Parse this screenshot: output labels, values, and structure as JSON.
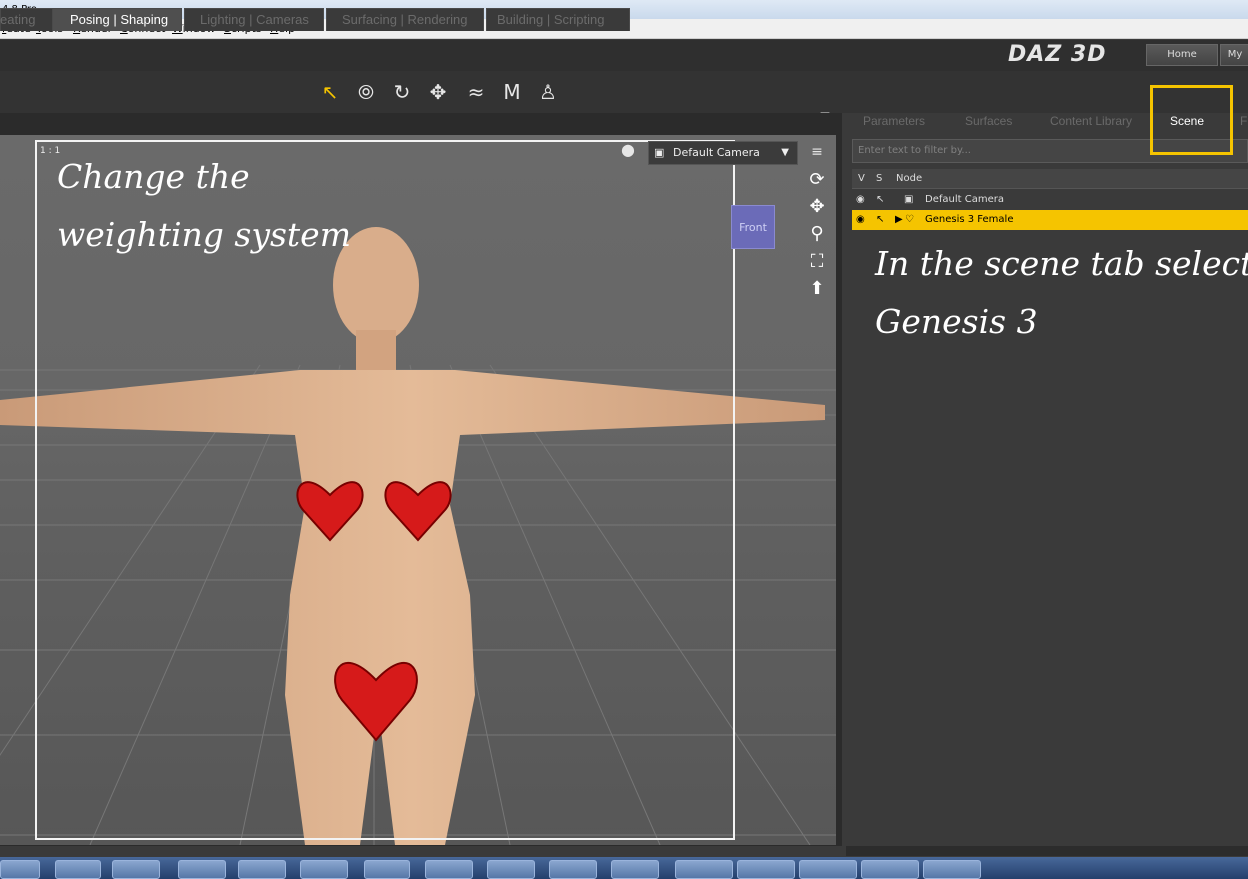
{
  "window": {
    "title": "4.8 Pro"
  },
  "menu": [
    "reate",
    "Tools",
    "Render",
    "Connect",
    "Window",
    "Scripts",
    "Help"
  ],
  "layout_tabs": [
    {
      "label": "eating",
      "active": false
    },
    {
      "label": "Posing | Shaping",
      "active": true
    },
    {
      "label": "Lighting | Cameras",
      "active": false
    },
    {
      "label": "Surfacing | Rendering",
      "active": false
    },
    {
      "label": "Building | Scripting",
      "active": false
    }
  ],
  "brand": {
    "logo": "DAZ 3D",
    "nav": [
      "Home",
      "My"
    ]
  },
  "tools": [
    "pointer-icon",
    "universal-tool-icon",
    "rotate-tool-icon",
    "translate-tool-icon",
    "scale-tool-icon",
    "morph-tool-icon",
    "figure-tool-icon"
  ],
  "viewport": {
    "ratio": "1 : 1",
    "camera": "Default Camera",
    "nav_cube_label": "Front",
    "annotation": [
      "Change the",
      "weighting system"
    ]
  },
  "right_tabs": [
    {
      "label": "Parameters",
      "active": false
    },
    {
      "label": "Surfaces",
      "active": false
    },
    {
      "label": "Content Library",
      "active": false
    },
    {
      "label": "Scene",
      "active": true
    },
    {
      "label": "F",
      "active": false
    }
  ],
  "scene": {
    "filter_placeholder": "Enter text to filter by...",
    "columns": [
      "V",
      "S",
      "Node"
    ],
    "nodes": [
      {
        "name": "Default Camera",
        "selected": false
      },
      {
        "name": "Genesis 3 Female",
        "selected": true
      }
    ],
    "annotation": [
      "In the scene tab select",
      "Genesis 3"
    ]
  },
  "colors": {
    "accent": "#f5c400",
    "selection": "#f5c400",
    "nav_cube": "#6b6bb8"
  }
}
